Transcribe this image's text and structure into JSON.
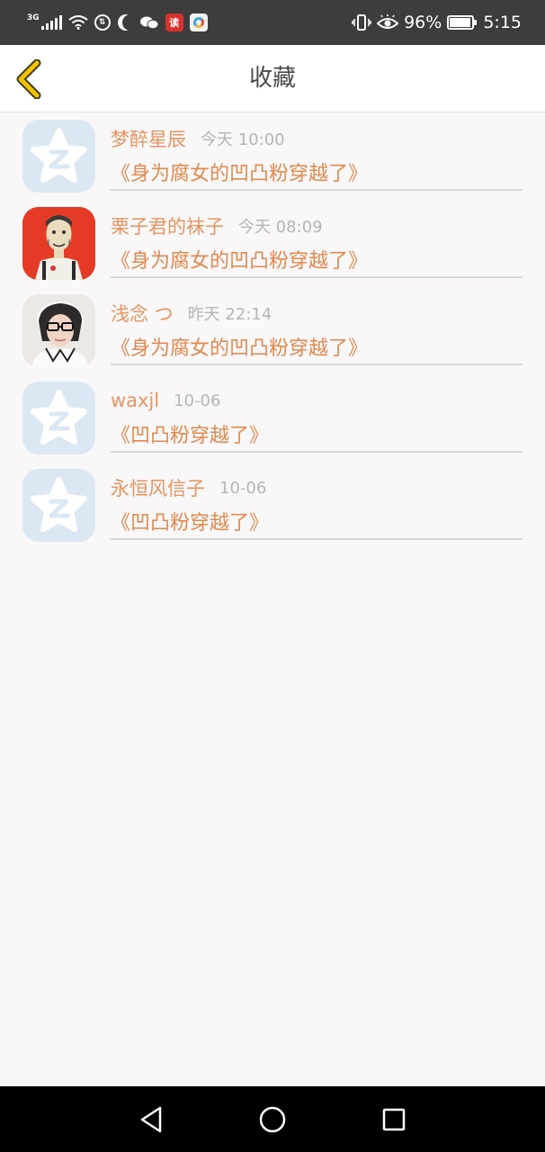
{
  "status_bar": {
    "network": "3G",
    "battery_percent": "96%",
    "battery_level": 0.96,
    "time": "5:15",
    "app_badge_text": "读"
  },
  "header": {
    "title": "收藏",
    "back_icon": "chevron-left-icon",
    "accent_color": "#f2c200"
  },
  "favorites": [
    {
      "name": "梦醉星辰",
      "time": "今天 10:00",
      "book": "《身为腐女的凹凸粉穿越了》",
      "avatar": "default-qq-avatar"
    },
    {
      "name": "栗子君的袜子",
      "time": "今天 08:09",
      "book": "《身为腐女的凹凸粉穿越了》",
      "avatar": "illustrated-man-avatar"
    },
    {
      "name": "浅念 つ",
      "time": "昨天 22:14",
      "book": "《身为腐女的凹凸粉穿越了》",
      "avatar": "photo-avatar"
    },
    {
      "name": "waxjl",
      "time": "10-06",
      "book": "《凹凸粉穿越了》",
      "avatar": "default-qq-avatar"
    },
    {
      "name": "永恒风信子",
      "time": "10-06",
      "book": "《凹凸粉穿越了》",
      "avatar": "default-qq-avatar"
    }
  ],
  "nav_bar": {
    "back": "triangle-back-icon",
    "home": "circle-home-icon",
    "recents": "square-recents-icon"
  }
}
